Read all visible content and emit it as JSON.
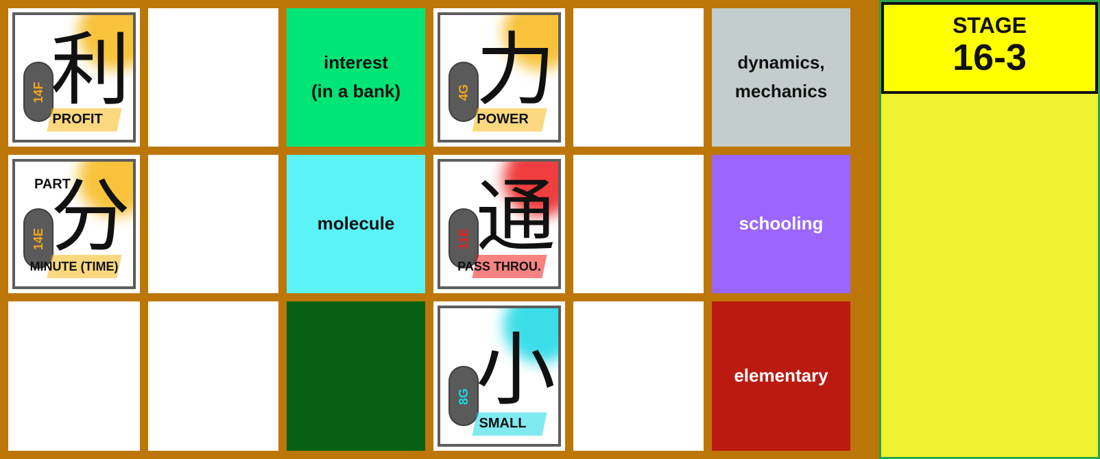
{
  "stage": {
    "label": "STAGE",
    "number": "16-3"
  },
  "cards": [
    {
      "kanji": "利",
      "level": "14F",
      "meaning": "PROFIT",
      "extra": "",
      "accent": "#f7b818",
      "level_color": "#f2a61d"
    },
    {
      "kanji": "力",
      "level": "4G",
      "meaning": "POWER",
      "extra": "",
      "accent": "#f7b818",
      "level_color": "#f2a61d"
    },
    {
      "kanji": "分",
      "level": "14E",
      "meaning": "MINUTE (TIME)",
      "extra": "PART",
      "accent": "#f7b818",
      "level_color": "#f2a61d"
    },
    {
      "kanji": "通",
      "level": "11E",
      "meaning": "PASS THROU.",
      "extra": "",
      "accent": "#ee1c1c",
      "level_color": "#ee1c1c"
    },
    {
      "kanji": "小",
      "level": "8G",
      "meaning": "SMALL",
      "extra": "",
      "accent": "#19d8e6",
      "level_color": "#19d8e6"
    }
  ],
  "words": [
    {
      "text": "interest\n(in a bank)",
      "bg": "#00e676",
      "color": "#111111"
    },
    {
      "text": "molecule",
      "bg": "#5cf3f7",
      "color": "#111111"
    },
    {
      "text": "",
      "bg": "#066114",
      "color": "#ffffff"
    },
    {
      "text": "dynamics,\nmechanics",
      "bg": "#c3cdcc",
      "color": "#111111"
    },
    {
      "text": "schooling",
      "bg": "#9a66ff",
      "color": "#ffffff"
    },
    {
      "text": "elementary",
      "bg": "#bb1a10",
      "color": "#ffffff"
    }
  ]
}
